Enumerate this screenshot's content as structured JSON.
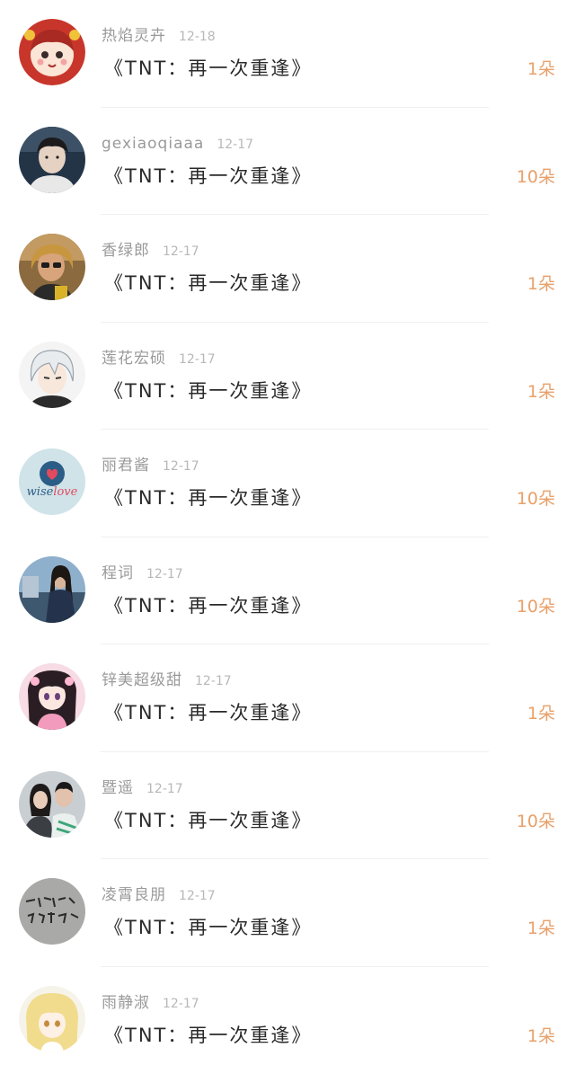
{
  "items": [
    {
      "username": "热焰灵卉",
      "date": "12-18",
      "title": "《TNT：再一次重逢》",
      "count": "1朵",
      "avatar_icon": "cartoon-girl-red-hair-avatar-icon"
    },
    {
      "username": "gexiaoqiaaa",
      "date": "12-17",
      "title": "《TNT：再一次重逢》",
      "count": "10朵",
      "avatar_icon": "young-man-photo-avatar-icon"
    },
    {
      "username": "香绿郎",
      "date": "12-17",
      "title": "《TNT：再一次重逢》",
      "count": "1朵",
      "avatar_icon": "woman-sunglasses-photo-avatar-icon"
    },
    {
      "username": "莲花宏硕",
      "date": "12-17",
      "title": "《TNT：再一次重逢》",
      "count": "1朵",
      "avatar_icon": "anime-white-hair-boy-avatar-icon"
    },
    {
      "username": "丽君酱",
      "date": "12-17",
      "title": "《TNT：再一次重逢》",
      "count": "10朵",
      "avatar_icon": "wiselove-logo-avatar-icon"
    },
    {
      "username": "程词",
      "date": "12-17",
      "title": "《TNT：再一次重逢》",
      "count": "10朵",
      "avatar_icon": "man-long-hair-photo-avatar-icon"
    },
    {
      "username": "锌美超级甜",
      "date": "12-17",
      "title": "《TNT：再一次重逢》",
      "count": "1朵",
      "avatar_icon": "anime-girl-pink-avatar-icon"
    },
    {
      "username": "暨遥",
      "date": "12-17",
      "title": "《TNT：再一次重逢》",
      "count": "10朵",
      "avatar_icon": "couple-photo-avatar-icon"
    },
    {
      "username": "凌霄良朋",
      "date": "12-17",
      "title": "《TNT：再一次重逢》",
      "count": "1朵",
      "avatar_icon": "handwriting-note-avatar-icon"
    },
    {
      "username": "雨静淑",
      "date": "12-17",
      "title": "《TNT：再一次重逢》",
      "count": "1朵",
      "avatar_icon": "anime-blonde-girl-avatar-icon"
    }
  ],
  "colors": {
    "username": "#9a9a9a",
    "date": "#b8b8b8",
    "title": "#2a2a2a",
    "count": "#e8a06a",
    "divider": "#f0f0f0"
  }
}
